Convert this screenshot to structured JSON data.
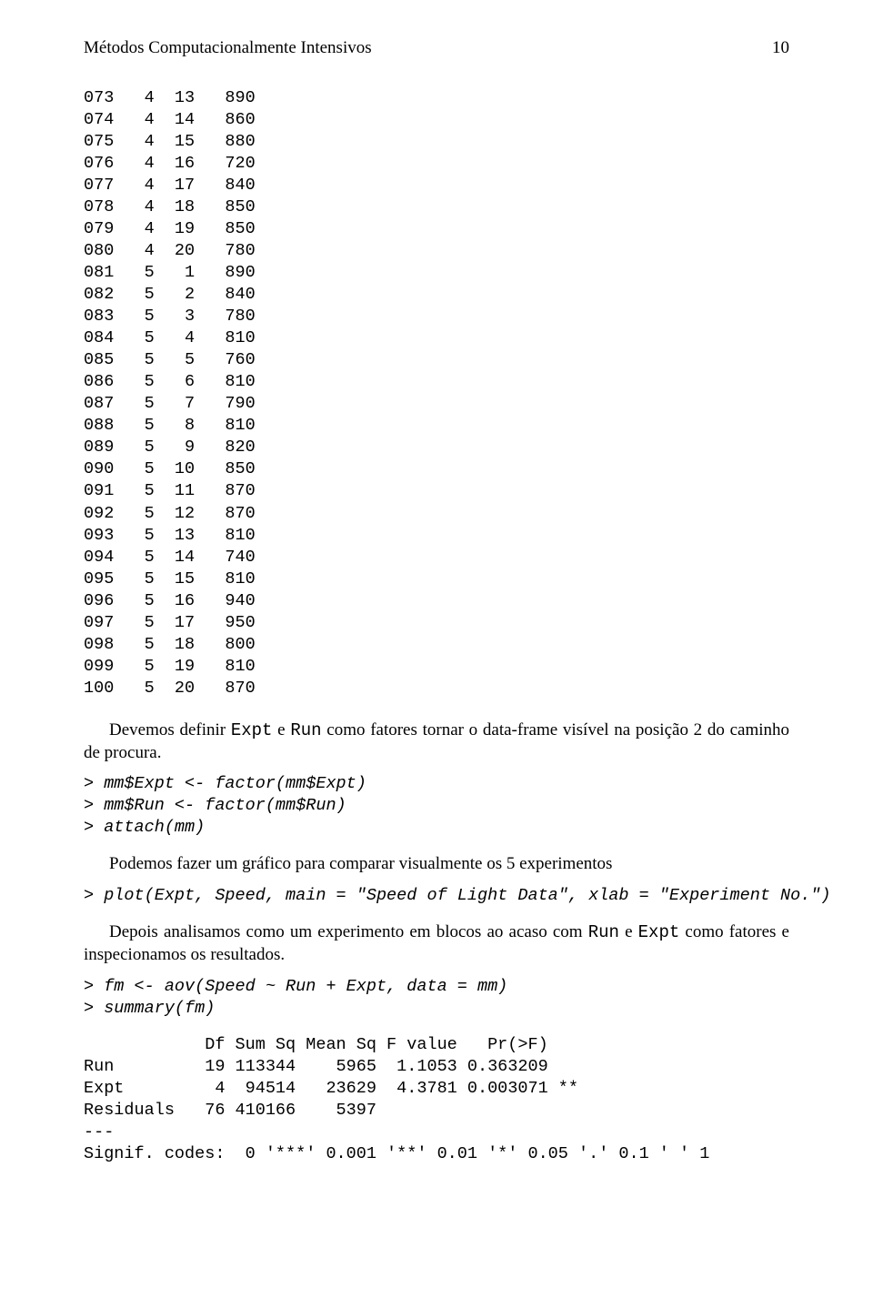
{
  "header": {
    "title": "Métodos Computacionalmente Intensivos",
    "page": "10"
  },
  "data_rows": [
    "073   4  13   890",
    "074   4  14   860",
    "075   4  15   880",
    "076   4  16   720",
    "077   4  17   840",
    "078   4  18   850",
    "079   4  19   850",
    "080   4  20   780",
    "081   5   1   890",
    "082   5   2   840",
    "083   5   3   780",
    "084   5   4   810",
    "085   5   5   760",
    "086   5   6   810",
    "087   5   7   790",
    "088   5   8   810",
    "089   5   9   820",
    "090   5  10   850",
    "091   5  11   870",
    "092   5  12   870",
    "093   5  13   810",
    "094   5  14   740",
    "095   5  15   810",
    "096   5  16   940",
    "097   5  17   950",
    "098   5  18   800",
    "099   5  19   810",
    "100   5  20   870"
  ],
  "para1": {
    "pre": "Devemos definir ",
    "tt1": "Expt",
    "mid1": " e ",
    "tt2": "Run",
    "post": " como fatores tornar o data-frame visível na posição 2 do caminho de procura."
  },
  "code1": "> mm$Expt <- factor(mm$Expt)\n> mm$Run <- factor(mm$Run)\n> attach(mm)",
  "para2": "Podemos fazer um gráfico para comparar visualmente os 5 experimentos",
  "code2": "> plot(Expt, Speed, main = \"Speed of Light Data\", xlab = \"Experiment No.\")",
  "para3": {
    "pre": "Depois analisamos como um experimento em blocos ao acaso com ",
    "tt1": "Run",
    "mid1": " e ",
    "tt2": "Expt",
    "post": " como fatores e inspecionamos os resultados."
  },
  "code3": "> fm <- aov(Speed ~ Run + Expt, data = mm)\n> summary(fm)",
  "output": "            Df Sum Sq Mean Sq F value   Pr(>F)\nRun         19 113344    5965  1.1053 0.363209\nExpt         4  94514   23629  4.3781 0.003071 **\nResiduals   76 410166    5397\n---\nSignif. codes:  0 '***' 0.001 '**' 0.01 '*' 0.05 '.' 0.1 ' ' 1"
}
